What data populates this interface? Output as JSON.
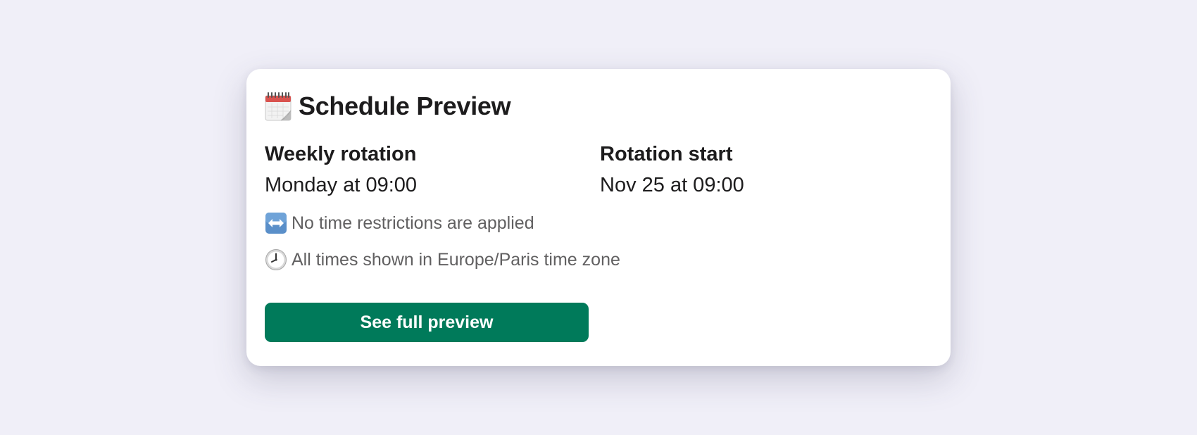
{
  "card": {
    "title": "Schedule Preview",
    "title_icon": "calendar-icon",
    "fields": [
      {
        "label": "Weekly rotation",
        "value": "Monday at 09:00"
      },
      {
        "label": "Rotation start",
        "value": "Nov 25 at 09:00"
      }
    ],
    "notes": [
      {
        "icon": "left-right-arrow-icon",
        "text": "No time restrictions are applied"
      },
      {
        "icon": "clock-icon",
        "text": "All times shown in Europe/Paris time zone"
      }
    ],
    "button_label": "See full preview"
  },
  "colors": {
    "page_background": "#f0eff8",
    "card_background": "#ffffff",
    "button_background": "#007a5a",
    "button_text": "#ffffff",
    "primary_text": "#1d1c1d",
    "secondary_text": "#616061"
  }
}
